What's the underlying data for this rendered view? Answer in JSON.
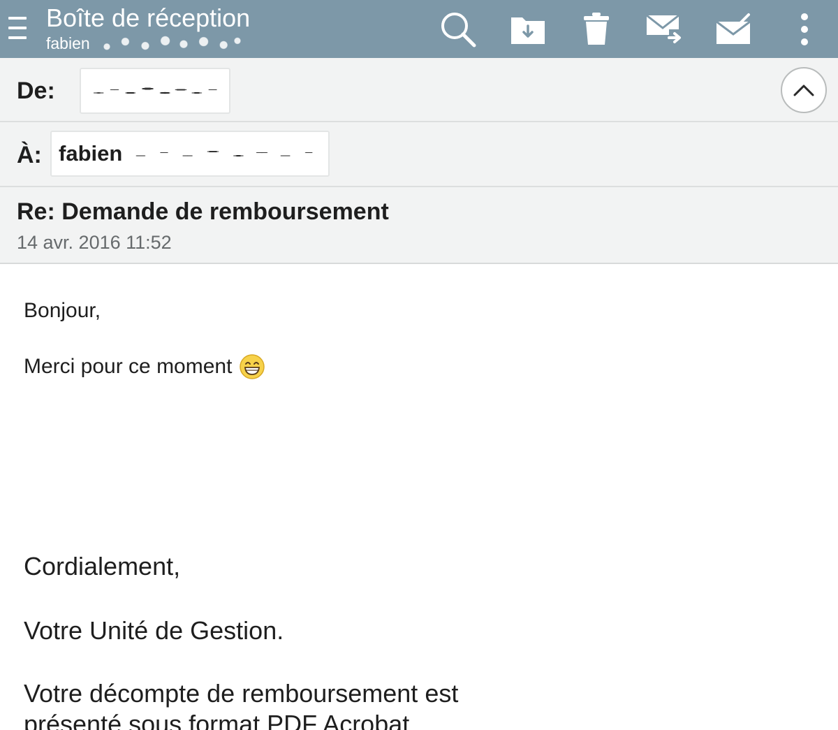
{
  "appbar": {
    "title": "Boîte de réception",
    "account": "fabien",
    "background_color": "#7d98a8",
    "icons": [
      "menu-icon",
      "search-icon",
      "move-to-folder-icon",
      "trash-icon",
      "forward-icon",
      "mark-read-icon",
      "more-vert-icon"
    ]
  },
  "header": {
    "from_label": "De:",
    "to_label": "À:",
    "to_value": "fabien",
    "subject": "Re: Demande de remboursement",
    "date": "14 avr. 2016 11:52",
    "collapse_icon": "chevron-up-icon"
  },
  "message": {
    "greeting": "Bonjour,",
    "line": "Merci pour ce moment",
    "emoji": "grinning-face-emoji",
    "closing": "Cordialement,",
    "signature": "Votre Unité de Gestion.",
    "note_line1": "Votre décompte de remboursement est",
    "note_line2": "présenté sous format PDF Acrobat"
  }
}
